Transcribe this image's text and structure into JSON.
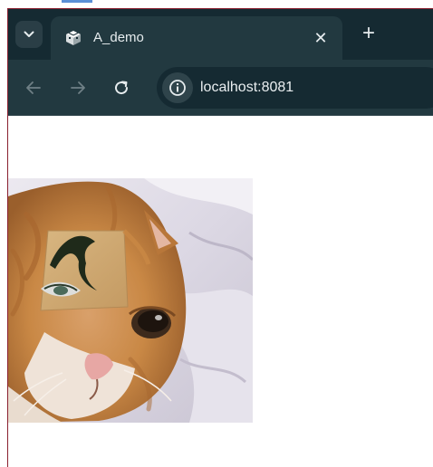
{
  "tab": {
    "title": "A_demo",
    "close_glyph": "✕",
    "favicon": "game-logo-icon"
  },
  "tabstrip": {
    "search_icon": "chevron-down-icon",
    "new_tab_glyph": "+"
  },
  "toolbar": {
    "back_icon": "arrow-left-icon",
    "forward_icon": "arrow-right-icon",
    "reload_icon": "reload-icon",
    "site_info_icon": "info-icon",
    "url": "localhost:8081"
  },
  "content": {
    "image": "cat-photo-with-drawn-eyebrow"
  },
  "colors": {
    "tabstrip_bg": "#152a32",
    "toolbar_bg": "#223940",
    "text": "#e6ecee",
    "page_bg": "#ffffff"
  }
}
